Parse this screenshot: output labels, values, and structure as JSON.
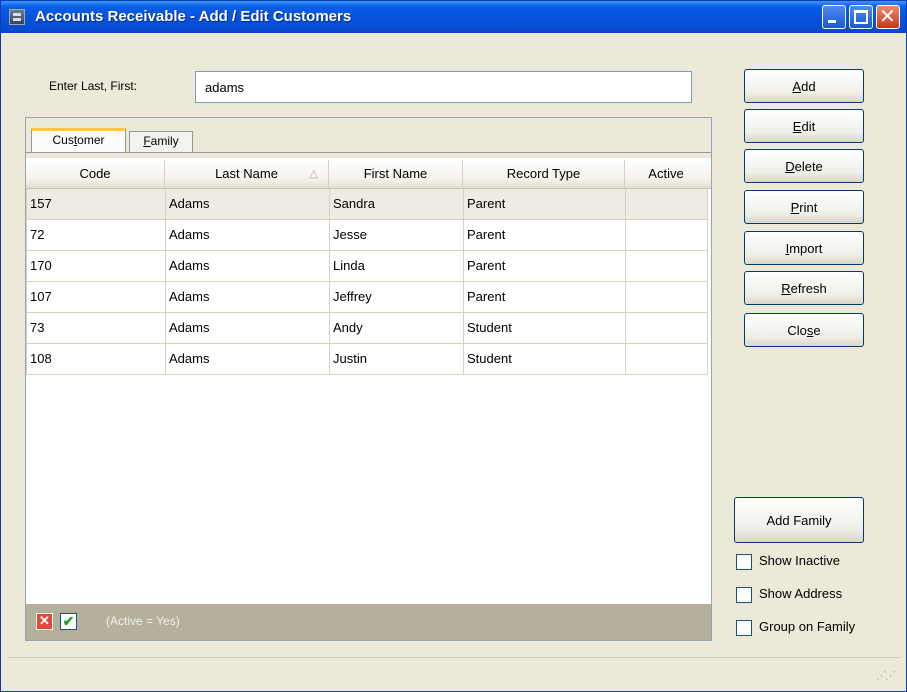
{
  "window": {
    "title": "Accounts Receivable - Add / Edit Customers",
    "controls": {
      "minimize": "_",
      "maximize": "□",
      "close": "✕"
    }
  },
  "search": {
    "label": "Enter Last, First:",
    "value": "adams"
  },
  "tabs": [
    {
      "label_pre": "Cus",
      "label_key": "t",
      "label_post": "omer",
      "active": true
    },
    {
      "label_pre": "",
      "label_key": "F",
      "label_post": "amily",
      "active": false
    }
  ],
  "grid": {
    "columns": [
      "Code",
      "Last Name",
      "First Name",
      "Record Type",
      "Active"
    ],
    "sort_indicator": "△",
    "rows": [
      {
        "code": "157",
        "last": "Adams",
        "first": "Sandra",
        "type": "Parent",
        "active": ""
      },
      {
        "code": "72",
        "last": "Adams",
        "first": "Jesse",
        "type": "Parent",
        "active": ""
      },
      {
        "code": "170",
        "last": "Adams",
        "first": "Linda",
        "type": "Parent",
        "active": ""
      },
      {
        "code": "107",
        "last": "Adams",
        "first": "Jeffrey",
        "type": "Parent",
        "active": ""
      },
      {
        "code": "73",
        "last": "Adams",
        "first": "Andy",
        "type": "Student",
        "active": ""
      },
      {
        "code": "108",
        "last": "Adams",
        "first": "Justin",
        "type": "Student",
        "active": ""
      }
    ],
    "selected_row": 0
  },
  "filter": {
    "text": "(Active = Yes)",
    "clear_glyph": "✕",
    "enabled_glyph": "✔"
  },
  "buttons": {
    "add": {
      "key": "A",
      "rest": "dd"
    },
    "edit": {
      "key": "E",
      "rest": "dit"
    },
    "delete": {
      "key": "D",
      "rest": "elete"
    },
    "print": {
      "key": "P",
      "rest": "rint"
    },
    "import": {
      "key": "I",
      "rest": "mport"
    },
    "refresh": {
      "key": "R",
      "rest": "efresh"
    },
    "close": {
      "pre": "Clo",
      "key": "s",
      "rest": "e"
    },
    "add_family": "Add Family"
  },
  "options": [
    {
      "label": "Show Inactive",
      "checked": false
    },
    {
      "label": "Show Address",
      "checked": false
    },
    {
      "label": "Group on Family",
      "checked": false
    }
  ],
  "colors": {
    "title_bar": "#0551dc",
    "face": "#ece9d8",
    "filter_bar": "#b4b09c",
    "tab_highlight": "#ffc83c"
  }
}
